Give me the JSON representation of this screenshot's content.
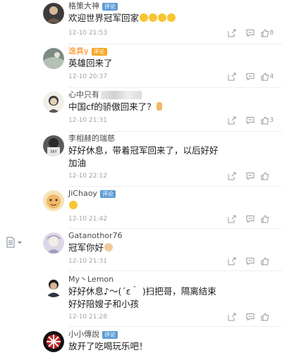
{
  "sidebar": {
    "doc_icon": "document-icon"
  },
  "comments": [
    {
      "name": "格策大神",
      "badge": "评论",
      "text": "欢迎世界冠军回家",
      "time": "12-10 21:53",
      "likes": "8",
      "avatar": "#3b3b3b"
    },
    {
      "name": "逸真y",
      "badge": "评论",
      "text": "英雄回来了",
      "time": "12-10 20:37",
      "likes": "4",
      "avatar": "#6c7b73"
    },
    {
      "name": "心中只有",
      "badge": "",
      "text": "中国cf的骄傲回来了？",
      "time": "12-10 21:31",
      "likes": "3",
      "avatar": "#d9d4c7"
    },
    {
      "name": "李相赫的瑞慈",
      "badge": "",
      "text": "好好休息，带着冠军回来了，以后好好",
      "text2": "加油",
      "time": "12-10 22:12",
      "likes": "",
      "avatar": "#444444"
    },
    {
      "name": "JiChaoy",
      "badge": "评论",
      "text": "",
      "time": "12-10 21:42",
      "likes": "",
      "avatar": "#f0c27a"
    },
    {
      "name": "Gatanothor76",
      "badge": "",
      "text": "冠军你好",
      "time": "12-10 21:31",
      "likes": "",
      "avatar": "#c9c2d8"
    },
    {
      "name": "My丶Lemon",
      "badge": "",
      "text": "好好休息♪～(´ε｀ )扫把哥，隔离结束",
      "text2": "好好陪嫂子和小孩",
      "time": "12-10 21:28",
      "likes": "",
      "avatar": "#2e3440"
    },
    {
      "name": "小小傳說",
      "badge": "评论",
      "text": "放开了吃喝玩乐吧！",
      "time": "",
      "likes": "",
      "avatar": "#b42525"
    }
  ]
}
